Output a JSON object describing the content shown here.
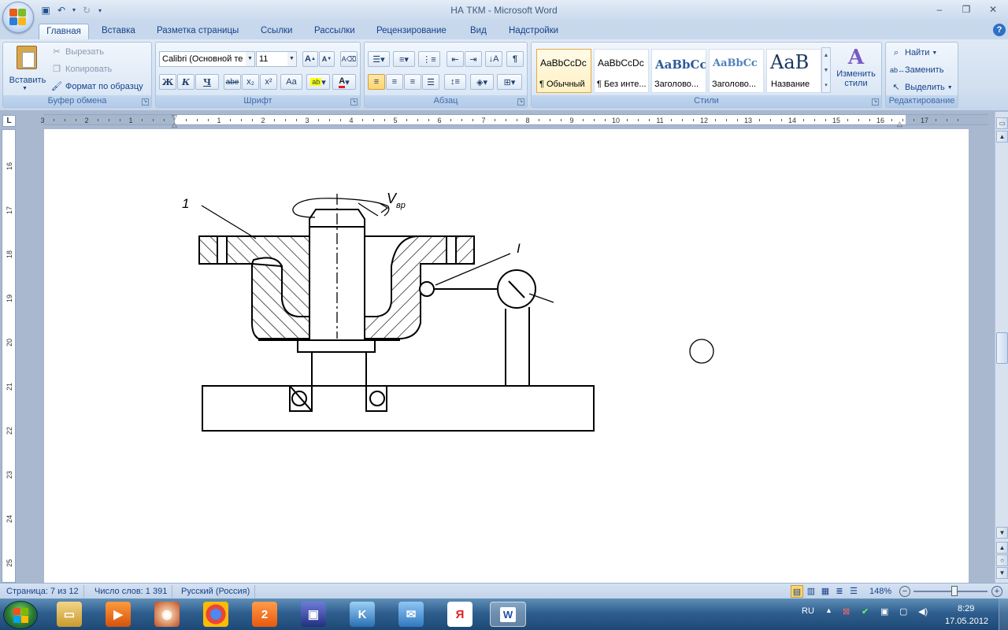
{
  "window": {
    "title": "НА ТКМ - Microsoft Word"
  },
  "tabs": [
    "Главная",
    "Вставка",
    "Разметка страницы",
    "Ссылки",
    "Рассылки",
    "Рецензирование",
    "Вид",
    "Надстройки"
  ],
  "active_tab": "Главная",
  "clipboard": {
    "label": "Буфер обмена",
    "paste": "Вставить",
    "cut": "Вырезать",
    "copy": "Копировать",
    "format_painter": "Формат по образцу"
  },
  "font": {
    "label": "Шрифт",
    "family": "Calibri (Основной те",
    "size": "11",
    "bold": "Ж",
    "italic": "К",
    "underline": "Ч",
    "strike": "abe",
    "sub": "x₂",
    "sup": "x²",
    "case": "Aa"
  },
  "paragraph": {
    "label": "Абзац"
  },
  "styles": {
    "label": "Стили",
    "items": [
      {
        "preview": "AaBbCcDc",
        "name": "¶ Обычный"
      },
      {
        "preview": "AaBbCcDc",
        "name": "¶ Без инте..."
      },
      {
        "preview": "AaBbCc",
        "name": "Заголово..."
      },
      {
        "preview": "AaBbCc",
        "name": "Заголово..."
      },
      {
        "preview": "AaB",
        "name": "Название"
      }
    ],
    "change": "Изменить стили"
  },
  "editing": {
    "label": "Редактирование",
    "find": "Найти",
    "replace": "Заменить",
    "select": "Выделить"
  },
  "ruler": {
    "h_left": [
      "3",
      "2",
      "1"
    ],
    "h_right": [
      "1",
      "2",
      "3",
      "4",
      "5",
      "6",
      "7",
      "8",
      "9",
      "10",
      "11",
      "12",
      "13",
      "14",
      "15",
      "16",
      "17"
    ],
    "v": [
      "16",
      "17",
      "18",
      "19",
      "20",
      "21",
      "22",
      "23",
      "24",
      "25"
    ]
  },
  "drawing": {
    "label_1": "1",
    "label_I": "I",
    "label_V": "V",
    "label_V_sub": "вр"
  },
  "status": {
    "page": "Страница: 7 из 12",
    "words": "Число слов: 1 391",
    "lang": "Русский (Россия)",
    "zoom": "148%"
  },
  "taskbar": {
    "lang": "RU",
    "time": "8:29",
    "date": "17.05.2012"
  },
  "colors": {
    "accent": "#15428b",
    "ribbon": "#dbe7f5",
    "taskbar": "#2f5f8f"
  }
}
